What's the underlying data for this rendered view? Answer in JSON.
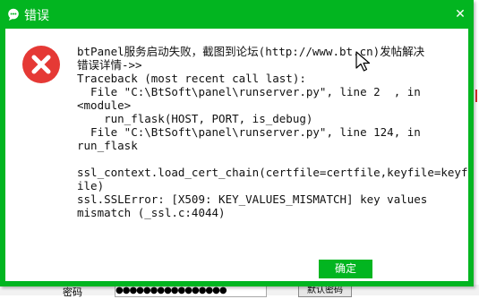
{
  "window": {
    "title": "错误",
    "close_symbol": "✕",
    "app_icon": "chat-bubble-icon",
    "colors": {
      "title_bar": "#02b520",
      "error_icon": "#e53935",
      "button": "#02b520"
    }
  },
  "message": {
    "lines": [
      "btPanel服务启动失败，截图到论坛(http://www.bt.cn)发帖解决",
      "错误详情->>",
      "Traceback (most recent call last):",
      "  File \"C:\\BtSoft\\panel\\runserver.py\", line 2  , in",
      "<module>",
      "    run_flask(HOST, PORT, is_debug)",
      "  File \"C:\\BtSoft\\panel\\runserver.py\", line 124, in",
      "run_flask",
      "",
      "ssl_context.load_cert_chain(certfile=certfile,keyfile=keyf",
      "ile)",
      "ssl.SSLError: [X509: KEY_VALUES_MISMATCH] key values",
      "mismatch (_ssl.c:4044)"
    ]
  },
  "buttons": {
    "ok_label": "确定"
  },
  "background": {
    "password_label": "密码",
    "password_mask": "●●●●●●●●●●●●●●●●",
    "default_button": "默认密码"
  }
}
